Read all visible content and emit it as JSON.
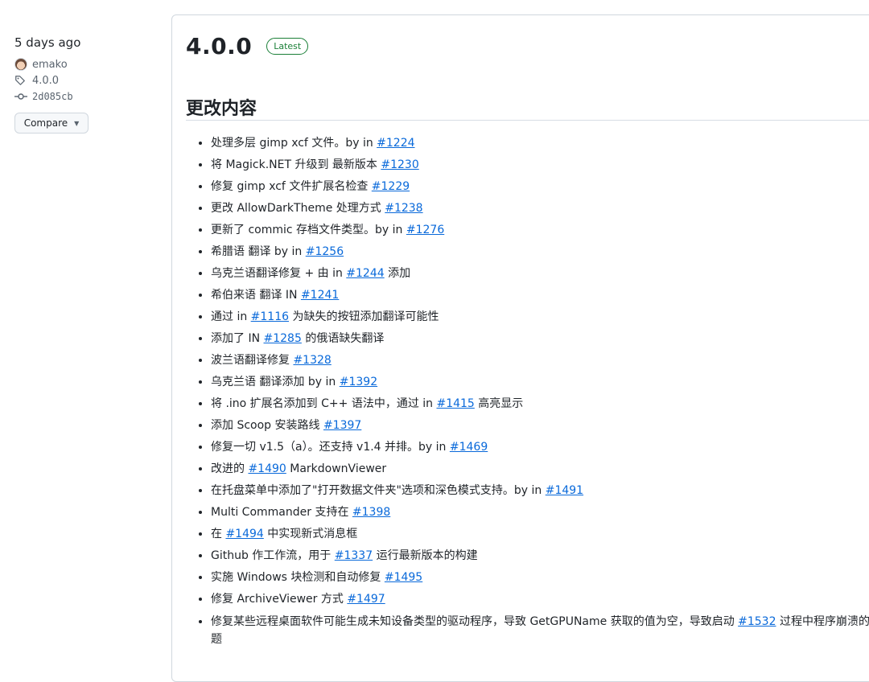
{
  "sidebar": {
    "time": "5 days ago",
    "author": "emako",
    "tag": "4.0.0",
    "commit": "2d085cb",
    "compare_label": "Compare"
  },
  "release": {
    "title": "4.0.0",
    "badge": "Latest",
    "section_heading": "更改内容",
    "items": [
      {
        "before": "处理多层 gimp xcf 文件。by in ",
        "link": "#1224",
        "after": ""
      },
      {
        "before": "将 Magick.NET 升级到 最新版本 ",
        "link": "#1230",
        "after": ""
      },
      {
        "before": "修复 gimp xcf 文件扩展名检查 ",
        "link": "#1229",
        "after": ""
      },
      {
        "before": "更改 AllowDarkTheme 处理方式 ",
        "link": "#1238",
        "after": ""
      },
      {
        "before": "更新了 commic 存档文件类型。by in ",
        "link": "#1276",
        "after": ""
      },
      {
        "before": "希腊语 翻译 by in ",
        "link": "#1256",
        "after": ""
      },
      {
        "before": "乌克兰语翻译修复 + 由 in ",
        "link": "#1244",
        "after": " 添加"
      },
      {
        "before": "希伯来语 翻译 IN ",
        "link": "#1241",
        "after": ""
      },
      {
        "before": "通过 in ",
        "link": "#1116",
        "after": " 为缺失的按钮添加翻译可能性"
      },
      {
        "before": "添加了 IN ",
        "link": "#1285",
        "after": " 的俄语缺失翻译"
      },
      {
        "before": "波兰语翻译修复 ",
        "link": "#1328",
        "after": ""
      },
      {
        "before": "乌克兰语 翻译添加 by in ",
        "link": "#1392",
        "after": ""
      },
      {
        "before": "将 .ino 扩展名添加到 C++ 语法中，通过 in ",
        "link": "#1415",
        "after": " 高亮显示"
      },
      {
        "before": "添加 Scoop 安装路线 ",
        "link": "#1397",
        "after": ""
      },
      {
        "before": "修复一切 v1.5（a）。还支持 v1.4 并排。by in ",
        "link": "#1469",
        "after": ""
      },
      {
        "before": "改进的 ",
        "link": "#1490",
        "after": " MarkdownViewer"
      },
      {
        "before": "在托盘菜单中添加了\"打开数据文件夹\"选项和深色模式支持。by in ",
        "link": "#1491",
        "after": ""
      },
      {
        "before": "Multi Commander 支持在 ",
        "link": "#1398",
        "after": ""
      },
      {
        "before": "在 ",
        "link": "#1494",
        "after": " 中实现新式消息框"
      },
      {
        "before": "Github 作工作流，用于 ",
        "link": "#1337",
        "after": " 运行最新版本的构建"
      },
      {
        "before": "实施 Windows 块检测和自动修复 ",
        "link": "#1495",
        "after": ""
      },
      {
        "before": "修复 ArchiveViewer 方式 ",
        "link": "#1497",
        "after": ""
      },
      {
        "before": "修复某些远程桌面软件可能生成未知设备类型的驱动程序，导致 GetGPUName 获取的值为空，导致启动 ",
        "link": "#1532",
        "after": " 过程中程序崩溃的问题"
      }
    ]
  }
}
